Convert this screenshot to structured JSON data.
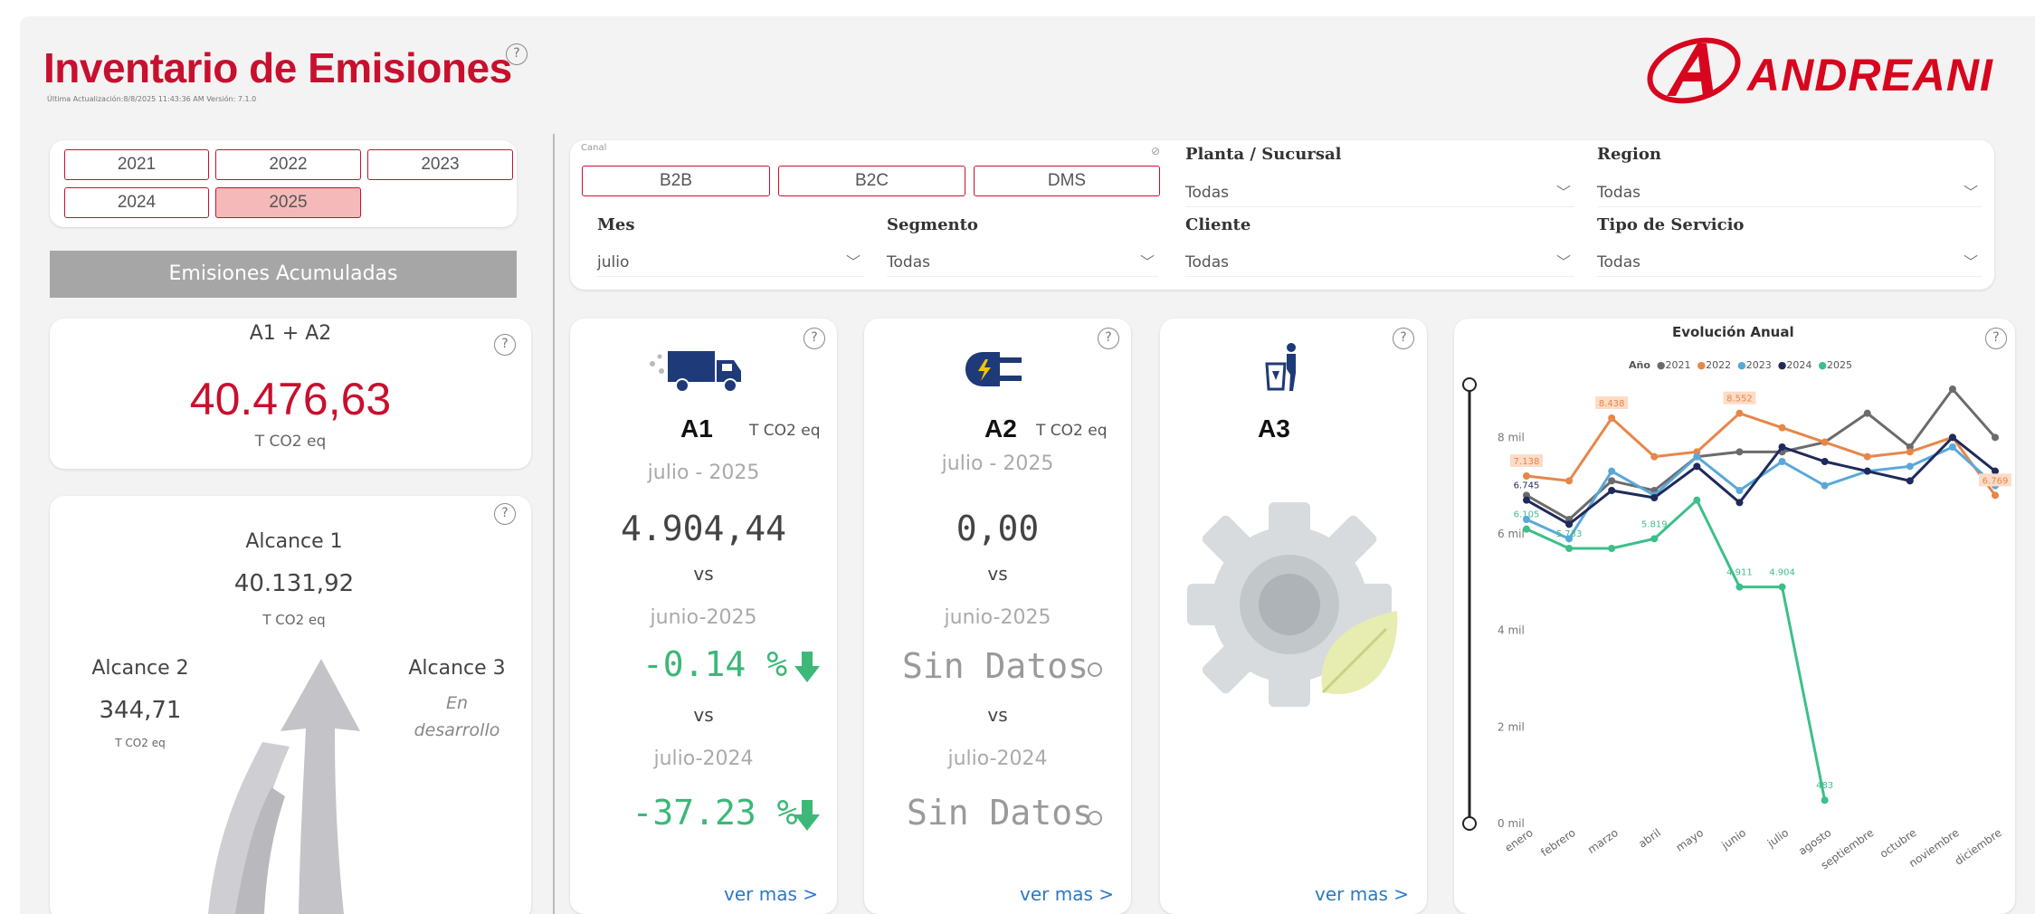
{
  "header": {
    "title": "Inventario de Emisiones",
    "subtitle": "Última Actualización:8/8/2025 11:43:36 AM   Versión: 7.1.0",
    "help": "?"
  },
  "logo": {
    "text": "ANDREANI",
    "color": "#d7061e"
  },
  "years": [
    "2021",
    "2022",
    "2023",
    "2024",
    "2025"
  ],
  "active_year": "2025",
  "emisiones_acumuladas": "Emisiones Acumuladas",
  "a1a2": {
    "label": "A1 + A2",
    "value": "40.476,63",
    "unit": "T CO2 eq"
  },
  "alcances": {
    "a1": {
      "label": "Alcance 1",
      "value": "40.131,92",
      "unit": "T CO2 eq"
    },
    "a2": {
      "label": "Alcance 2",
      "value": "344,71",
      "unit": "T CO2 eq"
    },
    "a3": {
      "label": "Alcance 3",
      "status": "En desarrollo"
    }
  },
  "filters": {
    "canal_label": "Canal",
    "canal": [
      "B2B",
      "B2C",
      "DMS"
    ],
    "planta": {
      "label": "Planta / Sucursal",
      "value": "Todas"
    },
    "region": {
      "label": "Region",
      "value": "Todas"
    },
    "mes": {
      "label": "Mes",
      "value": "julio"
    },
    "segmento": {
      "label": "Segmento",
      "value": "Todas"
    },
    "cliente": {
      "label": "Cliente",
      "value": "Todas"
    },
    "tipo_servicio": {
      "label": "Tipo de Servicio",
      "value": "Todas"
    }
  },
  "cards": {
    "a1": {
      "title": "A1",
      "unit": "T CO2 eq",
      "period": "julio - 2025",
      "value": "4.904,44",
      "vs": "vs",
      "prev_month": "junio-2025",
      "pct_month": "-0.14 %",
      "prev_year": "julio-2024",
      "pct_year": "-37.23 %",
      "link": "ver mas >"
    },
    "a2": {
      "title": "A2",
      "unit": "T CO2 eq",
      "period": "julio - 2025",
      "value": "0,00",
      "vs": "vs",
      "prev_month": "junio-2025",
      "pct_month": "Sin Datos",
      "prev_year": "julio-2024",
      "pct_year": "Sin Datos",
      "link": "ver mas >"
    },
    "a3": {
      "title": "A3",
      "link": "ver mas >"
    }
  },
  "chart_data": {
    "type": "line",
    "title": "Evolución Anual",
    "legend_title": "Año",
    "legend_position": "top",
    "categories": [
      "enero",
      "febrero",
      "marzo",
      "abril",
      "mayo",
      "junio",
      "julio",
      "agosto",
      "septiembre",
      "octubre",
      "noviembre",
      "diciembre"
    ],
    "y_ticks": [
      "0 mil",
      "2 mil",
      "4 mil",
      "6 mil",
      "8 mil"
    ],
    "ylim": [
      0,
      9000
    ],
    "grid": false,
    "series": [
      {
        "name": "2021",
        "color": "#6b6b6b",
        "values": [
          6800,
          6300,
          7100,
          6900,
          7600,
          7700,
          7700,
          7900,
          8500,
          7800,
          9000,
          8000
        ]
      },
      {
        "name": "2022",
        "color": "#e8864a",
        "values": [
          7200,
          7100,
          8400,
          7600,
          7700,
          8500,
          8200,
          7900,
          7600,
          7700,
          8000,
          6800
        ]
      },
      {
        "name": "2023",
        "color": "#5aa8d8",
        "values": [
          6300,
          5900,
          7300,
          6800,
          7600,
          6900,
          7500,
          7000,
          7300,
          7400,
          7800,
          7000
        ]
      },
      {
        "name": "2024",
        "color": "#1f2a5a",
        "values": [
          6700,
          6200,
          6900,
          6750,
          7400,
          6650,
          7800,
          7500,
          7300,
          7100,
          8000,
          7300
        ]
      },
      {
        "name": "2025",
        "color": "#3cbf8a",
        "values": [
          6100,
          5700,
          5700,
          5900,
          6700,
          4900,
          4900,
          483,
          null,
          null,
          null,
          null
        ]
      }
    ],
    "data_labels": [
      {
        "series": "2022",
        "index": 0,
        "text": "7.138"
      },
      {
        "series": "2022",
        "index": 2,
        "text": "8.438"
      },
      {
        "series": "2022",
        "index": 5,
        "text": "8.552"
      },
      {
        "series": "2022",
        "index": 11,
        "text": "6.769"
      },
      {
        "series": "2024",
        "index": 0,
        "text": "6.745"
      },
      {
        "series": "2025",
        "index": 0,
        "text": "6.105"
      },
      {
        "series": "2025",
        "index": 1,
        "text": "5.733"
      },
      {
        "series": "2025",
        "index": 3,
        "text": "5.819"
      },
      {
        "series": "2025",
        "index": 5,
        "text": "4.911"
      },
      {
        "series": "2025",
        "index": 6,
        "text": "4.904"
      },
      {
        "series": "2025",
        "index": 7,
        "text": "483"
      }
    ]
  }
}
